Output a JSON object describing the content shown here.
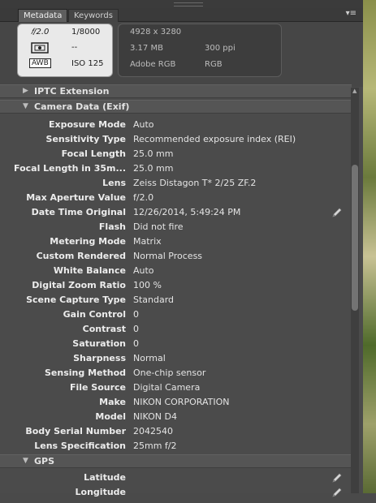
{
  "tabs": {
    "metadata": "Metadata",
    "keywords": "Keywords"
  },
  "camera": {
    "fnumber": "𝑓/2.0",
    "shutter": "1/8000",
    "metering_val": "--",
    "wb": "AWB",
    "iso": "ISO 125"
  },
  "file": {
    "dimensions": "4928 x 3280",
    "size": "3.17 MB",
    "resolution": "300 ppi",
    "profile": "Adobe RGB",
    "mode": "RGB"
  },
  "sections": {
    "iptc": "IPTC Extension",
    "exif": "Camera Data (Exif)",
    "gps": "GPS"
  },
  "exif": [
    {
      "label": "Exposure Mode",
      "value": "Auto"
    },
    {
      "label": "Sensitivity Type",
      "value": "Recommended exposure index (REI)"
    },
    {
      "label": "Focal Length",
      "value": "25.0 mm"
    },
    {
      "label": "Focal Length in 35m...",
      "value": "25.0 mm"
    },
    {
      "label": "Lens",
      "value": "Zeiss Distagon T* 2/25 ZF.2"
    },
    {
      "label": "Max Aperture Value",
      "value": "f/2.0"
    },
    {
      "label": "Date Time Original",
      "value": "12/26/2014, 5:49:24 PM"
    },
    {
      "label": "Flash",
      "value": "Did not fire"
    },
    {
      "label": "Metering Mode",
      "value": "Matrix"
    },
    {
      "label": "Custom Rendered",
      "value": "Normal Process"
    },
    {
      "label": "White Balance",
      "value": "Auto"
    },
    {
      "label": "Digital Zoom Ratio",
      "value": "100 %"
    },
    {
      "label": "Scene Capture Type",
      "value": "Standard"
    },
    {
      "label": "Gain Control",
      "value": "0"
    },
    {
      "label": "Contrast",
      "value": "0"
    },
    {
      "label": "Saturation",
      "value": "0"
    },
    {
      "label": "Sharpness",
      "value": "Normal"
    },
    {
      "label": "Sensing Method",
      "value": "One-chip sensor"
    },
    {
      "label": "File Source",
      "value": "Digital Camera"
    },
    {
      "label": "Make",
      "value": "NIKON CORPORATION"
    },
    {
      "label": "Model",
      "value": "NIKON D4"
    },
    {
      "label": "Body Serial Number",
      "value": "2042540"
    },
    {
      "label": "Lens Specification",
      "value": "25mm f/2"
    }
  ],
  "gps": [
    {
      "label": "Latitude",
      "value": ""
    },
    {
      "label": "Longitude",
      "value": ""
    }
  ]
}
